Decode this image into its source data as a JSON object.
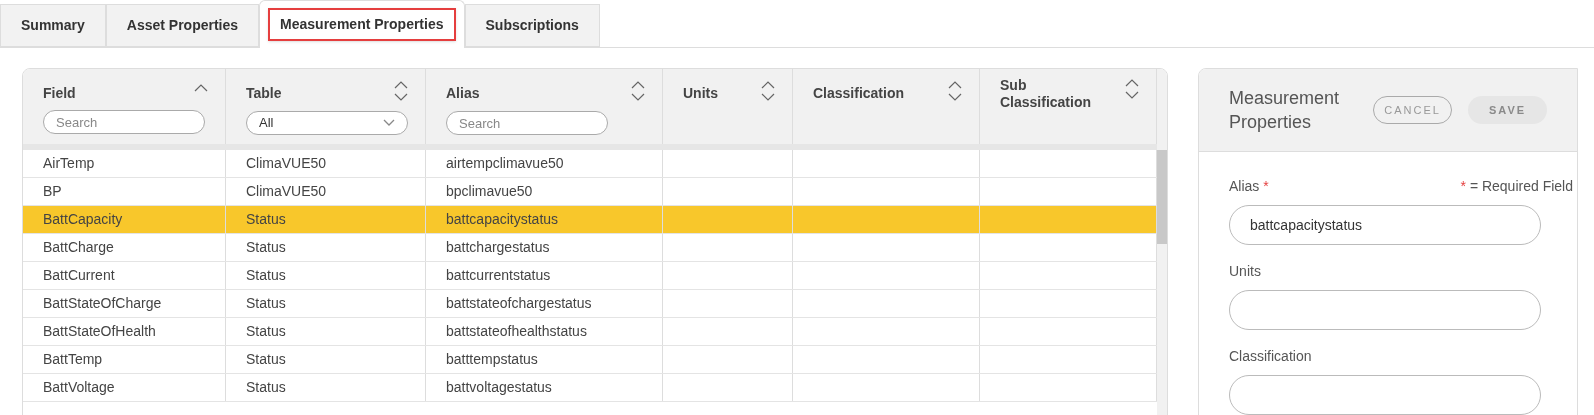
{
  "tabs": [
    {
      "label": "Summary",
      "selected": false
    },
    {
      "label": "Asset Properties",
      "selected": false
    },
    {
      "label": "Measurement Properties",
      "selected": true
    },
    {
      "label": "Subscriptions",
      "selected": false
    }
  ],
  "table": {
    "columns": [
      {
        "label": "Field",
        "sorted_ascending": true,
        "filter": {
          "kind": "search",
          "placeholder": "Search"
        }
      },
      {
        "label": "Table",
        "sorted_ascending": false,
        "filter": {
          "kind": "select",
          "value": "All"
        }
      },
      {
        "label": "Alias",
        "sorted_ascending": false,
        "filter": {
          "kind": "search",
          "placeholder": "Search"
        }
      },
      {
        "label": "Units",
        "sorted_ascending": false
      },
      {
        "label": "Classification",
        "sorted_ascending": false
      },
      {
        "label": "Sub Classification",
        "sorted_ascending": false
      }
    ],
    "rows": [
      {
        "cells": [
          "AirTemp",
          "ClimaVUE50",
          "airtempclimavue50",
          "",
          "",
          ""
        ],
        "selected": false
      },
      {
        "cells": [
          "BP",
          "ClimaVUE50",
          "bpclimavue50",
          "",
          "",
          ""
        ],
        "selected": false
      },
      {
        "cells": [
          "BattCapacity",
          "Status",
          "battcapacitystatus",
          "",
          "",
          ""
        ],
        "selected": true
      },
      {
        "cells": [
          "BattCharge",
          "Status",
          "battchargestatus",
          "",
          "",
          ""
        ],
        "selected": false
      },
      {
        "cells": [
          "BattCurrent",
          "Status",
          "battcurrentstatus",
          "",
          "",
          ""
        ],
        "selected": false
      },
      {
        "cells": [
          "BattStateOfCharge",
          "Status",
          "battstateofchargestatus",
          "",
          "",
          ""
        ],
        "selected": false
      },
      {
        "cells": [
          "BattStateOfHealth",
          "Status",
          "battstateofhealthstatus",
          "",
          "",
          ""
        ],
        "selected": false
      },
      {
        "cells": [
          "BattTemp",
          "Status",
          "batttempstatus",
          "",
          "",
          ""
        ],
        "selected": false
      },
      {
        "cells": [
          "BattVoltage",
          "Status",
          "battvoltagestatus",
          "",
          "",
          ""
        ],
        "selected": false
      }
    ]
  },
  "panel": {
    "title": "Measurement Properties",
    "buttons": [
      {
        "label": "CANCEL",
        "disabled": false
      },
      {
        "label": "SAVE",
        "disabled": true
      }
    ],
    "required_note": {
      "mark": "*",
      "text": "= Required Field"
    },
    "fields": [
      {
        "label": "Alias",
        "required": true,
        "value": "battcapacitystatus"
      },
      {
        "label": "Units",
        "required": false
      },
      {
        "label": "Classification",
        "required": false
      }
    ]
  }
}
